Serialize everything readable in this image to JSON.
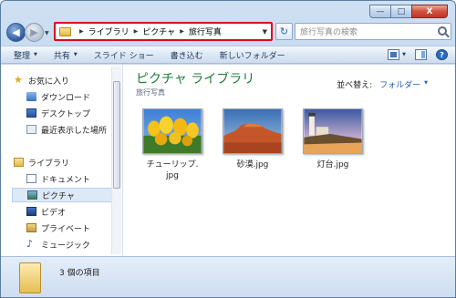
{
  "window": {
    "caption_buttons": {
      "minimize": "—",
      "maximize": "□",
      "close": "X"
    }
  },
  "nav": {
    "breadcrumb": [
      "ライブラリ",
      "ピクチャ",
      "旅行写真"
    ],
    "search_placeholder": "旅行写真の検索"
  },
  "toolbar": {
    "organize": "整理",
    "share": "共有",
    "slideshow": "スライド ショー",
    "burn": "書き込む",
    "new_folder": "新しいフォルダー",
    "help_glyph": "?"
  },
  "sidebar": {
    "favorites": "お気に入り",
    "downloads": "ダウンロード",
    "desktop": "デスクトップ",
    "recent": "最近表示した場所",
    "libraries": "ライブラリ",
    "documents": "ドキュメント",
    "pictures": "ピクチャ",
    "videos": "ビデオ",
    "private": "プライベート",
    "music": "ミュージック"
  },
  "main": {
    "title": "ピクチャ ライブラリ",
    "subtitle": "旅行写真",
    "arrange_label": "並べ替え:",
    "arrange_value": "フォルダー",
    "files": [
      {
        "name_line1": "チューリップ.",
        "name_line2": "jpg"
      },
      {
        "name_line1": "砂漠.jpg",
        "name_line2": ""
      },
      {
        "name_line1": "灯台.jpg",
        "name_line2": ""
      }
    ]
  },
  "status": {
    "count_text": "3 個の項目"
  },
  "colors": {
    "highlight_border": "#e0061f",
    "library_title": "#1e7a3a"
  }
}
